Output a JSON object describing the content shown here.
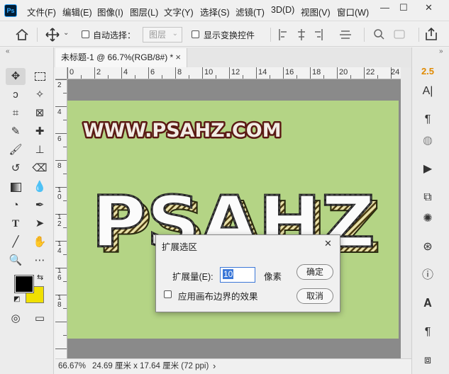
{
  "app": {
    "logo": "Ps"
  },
  "menu": [
    "文件(F)",
    "编辑(E)",
    "图像(I)",
    "图层(L)",
    "文字(Y)",
    "选择(S)",
    "滤镜(T)",
    "3D(D)",
    "视图(V)",
    "窗口(W)"
  ],
  "window_controls": {
    "minimize": "—",
    "maximize": "☐",
    "close": "✕"
  },
  "options_bar": {
    "auto_select_label": "自动选择：",
    "auto_select_target": "图层",
    "show_transform_label": "显示变换控件"
  },
  "document_tab": {
    "title": "未标题-1 @ 66.7%(RGB/8#) *",
    "close": "×"
  },
  "rulers": {
    "horizontal_labels": [
      "0",
      "2",
      "4",
      "6",
      "8",
      "10",
      "12",
      "14",
      "16",
      "18",
      "20",
      "22",
      "24"
    ],
    "vertical_labels": [
      "2",
      "4",
      "6",
      "8",
      "1\n0",
      "1\n2",
      "1\n4",
      "1\n6",
      "1\n8"
    ]
  },
  "canvas": {
    "headline": "WWW.PSAHZ.COM",
    "big_text": "PSAHZ",
    "background_color": "#b4d485",
    "headline_color": "#f2ece4",
    "headline_outline": "#5a1a14"
  },
  "right_panel": {
    "version_label": "2.5",
    "text_glyph": "A|"
  },
  "colors": {
    "foreground": "#000000",
    "background": "#f0e000"
  },
  "dialog": {
    "title": "扩展选区",
    "expand_label": "扩展量(E):",
    "expand_value": "10",
    "unit": "像素",
    "checkbox_label": "应用画布边界的效果",
    "ok_label": "确定",
    "cancel_label": "取消",
    "close": "✕"
  },
  "status_bar": {
    "zoom": "66.67%",
    "doc_size": "24.69 厘米 x 17.64 厘米 (72 ppi)",
    "arrow": "›"
  }
}
